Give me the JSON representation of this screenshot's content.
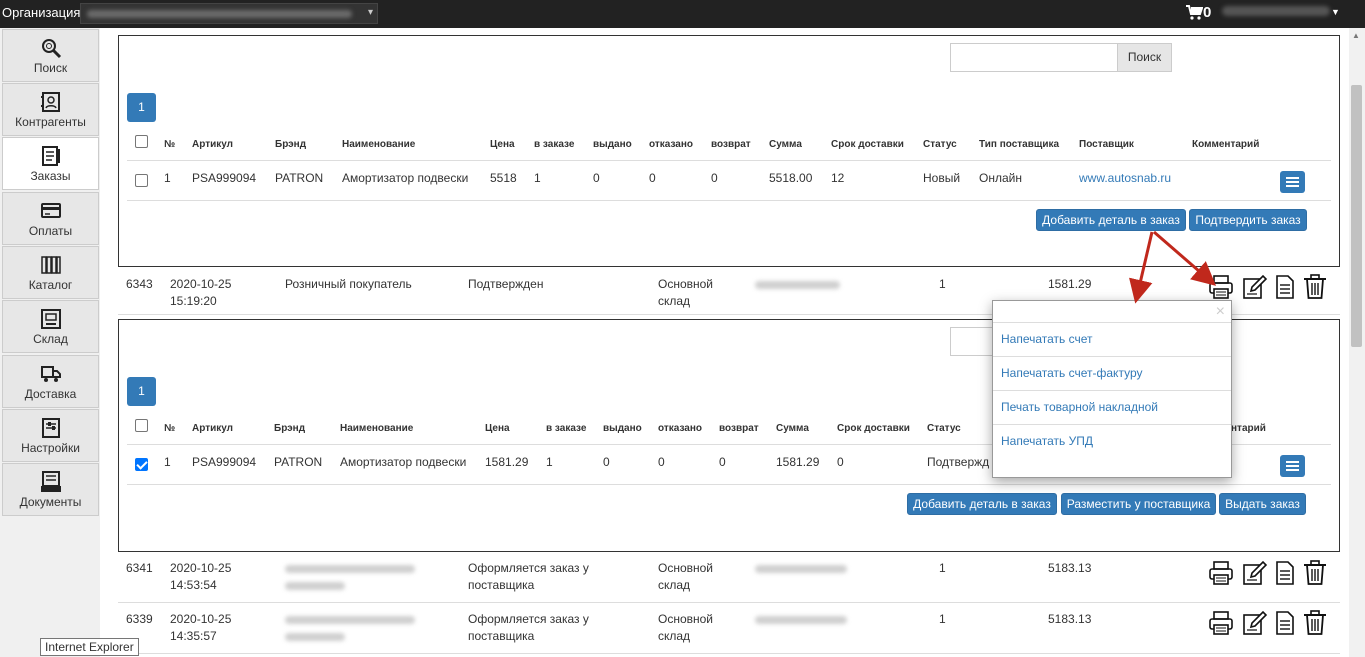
{
  "topbar": {
    "org_label": "Организация:",
    "cart_count": "0"
  },
  "sidebar": {
    "items": [
      {
        "label": "Поиск",
        "icon": "search-icon"
      },
      {
        "label": "Контрагенты",
        "icon": "contacts-icon"
      },
      {
        "label": "Заказы",
        "icon": "orders-icon"
      },
      {
        "label": "Оплаты",
        "icon": "payments-icon"
      },
      {
        "label": "Каталог",
        "icon": "catalog-icon"
      },
      {
        "label": "Склад",
        "icon": "warehouse-icon"
      },
      {
        "label": "Доставка",
        "icon": "delivery-icon"
      },
      {
        "label": "Настройки",
        "icon": "settings-icon"
      },
      {
        "label": "Документы",
        "icon": "documents-icon"
      }
    ],
    "active": "Заказы"
  },
  "search": {
    "button_label": "Поиск",
    "value": ""
  },
  "table_headers": [
    "№",
    "Артикул",
    "Брэнд",
    "Наименование",
    "Цена",
    "в заказе",
    "выдано",
    "отказано",
    "возврат",
    "Сумма",
    "Срок доставки",
    "Статус",
    "Тип поставщика",
    "Поставщик",
    "Комментарий"
  ],
  "panel1": {
    "page": "1",
    "row": {
      "num": "1",
      "article": "PSA999094",
      "brand": "PATRON",
      "name": "Амортизатор подвески",
      "price": "5518",
      "ordered": "1",
      "issued": "0",
      "refused": "0",
      "returned": "0",
      "sum": "5518.00",
      "delivery": "12",
      "status": "Новый",
      "supplier_type": "Онлайн",
      "supplier": "www.autosnab.ru"
    },
    "buttons": {
      "add": "Добавить деталь в заказ",
      "confirm": "Подтвердить заказ"
    }
  },
  "orders": [
    {
      "id": "6343",
      "date": "2020-10-25",
      "time": "15:19:20",
      "client": "Розничный покупатель",
      "status": "Подтвержден",
      "warehouse1": "Основной",
      "warehouse2": "склад",
      "qty": "1",
      "total": "1581.29"
    },
    {
      "id": "6341",
      "date": "2020-10-25",
      "time": "14:53:54",
      "client": "",
      "status1": "Оформляется заказ у",
      "status2": "поставщика",
      "warehouse1": "Основной",
      "warehouse2": "склад",
      "qty": "1",
      "total": "5183.13"
    },
    {
      "id": "6339",
      "date": "2020-10-25",
      "time": "14:35:57",
      "client": "",
      "status1": "Оформляется заказ у",
      "status2": "поставщика",
      "warehouse1": "Основной",
      "warehouse2": "склад",
      "qty": "1",
      "total": "5183.13"
    }
  ],
  "panel2": {
    "page": "1",
    "row": {
      "num": "1",
      "article": "PSA999094",
      "brand": "PATRON",
      "name": "Амортизатор подвески",
      "price": "1581.29",
      "ordered": "1",
      "issued": "0",
      "refused": "0",
      "returned": "0",
      "sum": "1581.29",
      "delivery": "0",
      "status": "Подтвержд"
    },
    "comment_header_partial": "нтарий",
    "buttons": {
      "add": "Добавить деталь в заказ",
      "place": "Разместить у поставщика",
      "issue": "Выдать заказ"
    }
  },
  "popup": {
    "items": [
      "Напечатать счет",
      "Напечатать счет-фактуру",
      "Печать товарной накладной",
      "Напечатать УПД"
    ]
  },
  "tooltip": "Internet Explorer",
  "colors": {
    "primary": "#337ab7",
    "topbar": "#222222",
    "annotation_arrow": "#c0281c"
  }
}
